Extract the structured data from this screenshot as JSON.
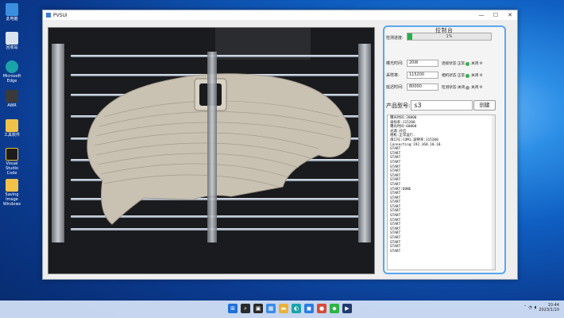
{
  "desktop": {
    "icons": [
      {
        "label": "此电脑",
        "color": "#3b8fe0"
      },
      {
        "label": "回收站",
        "color": "#d9e4ef"
      },
      {
        "label": "Microsoft Edge",
        "color": "#1aa3a8"
      },
      {
        "label": "AWR",
        "color": "#3a3a3a"
      },
      {
        "label": "工具软件",
        "color": "#f2c14a"
      },
      {
        "label": "Visual Studio Code",
        "color": "#1c1c1c"
      },
      {
        "label": "Saving Image Windows",
        "color": "#f2c14a"
      }
    ]
  },
  "window": {
    "title": "PVSUI",
    "controls": {
      "minimize": "—",
      "maximize": "☐",
      "close": "✕"
    }
  },
  "panel": {
    "title": "控制台",
    "progress_label": "检测进度:",
    "progress_text": "1%",
    "progress_value": 0.06,
    "fields": [
      {
        "label": "曝光时间:",
        "value": "20W"
      },
      {
        "label": "采样率:",
        "value": "115200"
      },
      {
        "label": "延迟时间:",
        "value": "80000"
      }
    ],
    "statuses": [
      {
        "label": "连接状态:",
        "value": "正常",
        "dot": "green",
        "trail": "关闭"
      },
      {
        "label": "相机状态:",
        "value": "正常",
        "dot": "green",
        "trail": "关闭"
      },
      {
        "label": "检测状态:",
        "value": "关闭",
        "dot": "gray",
        "trail": "关闭"
      }
    ],
    "product_label": "产品型号:",
    "product_value": "s3",
    "create_button": "创建",
    "log": [
      "曝光时间:20000",
      "采样率:115200",
      "曝光时间:60000",
      "光源:开启",
      "相机:正常运行.",
      "串口号:COM1,波特率:115200",
      "Connecting:192.168.10.10.",
      "START",
      "START",
      "START",
      "START",
      "START",
      "START",
      "START",
      "START",
      "START",
      "START:DONE",
      "START",
      "START",
      "START",
      "START",
      "START",
      "START",
      "START",
      "START",
      "START",
      "START",
      "START",
      "START",
      "START",
      "START"
    ]
  },
  "taskbar": {
    "apps": [
      {
        "name": "windows-start",
        "glyph": "⊞",
        "color": "#1d6fd8"
      },
      {
        "name": "search",
        "glyph": "⌕",
        "color": "#2a2a2a"
      },
      {
        "name": "task-view",
        "glyph": "▣",
        "color": "#2a2a2a"
      },
      {
        "name": "widgets",
        "glyph": "▦",
        "color": "#3a8be8"
      },
      {
        "name": "file-explorer",
        "glyph": "▬",
        "color": "#e8b23a"
      },
      {
        "name": "edge",
        "glyph": "◐",
        "color": "#1aa3a8"
      },
      {
        "name": "store",
        "glyph": "◼",
        "color": "#2b7de0"
      },
      {
        "name": "chrome",
        "glyph": "●",
        "color": "#d94a3a"
      },
      {
        "name": "app-green",
        "glyph": "◆",
        "color": "#2fb344"
      },
      {
        "name": "pvs-app",
        "glyph": "▶",
        "color": "#1f3a6b"
      }
    ],
    "time": "10:44",
    "date": "2023/1/10"
  }
}
